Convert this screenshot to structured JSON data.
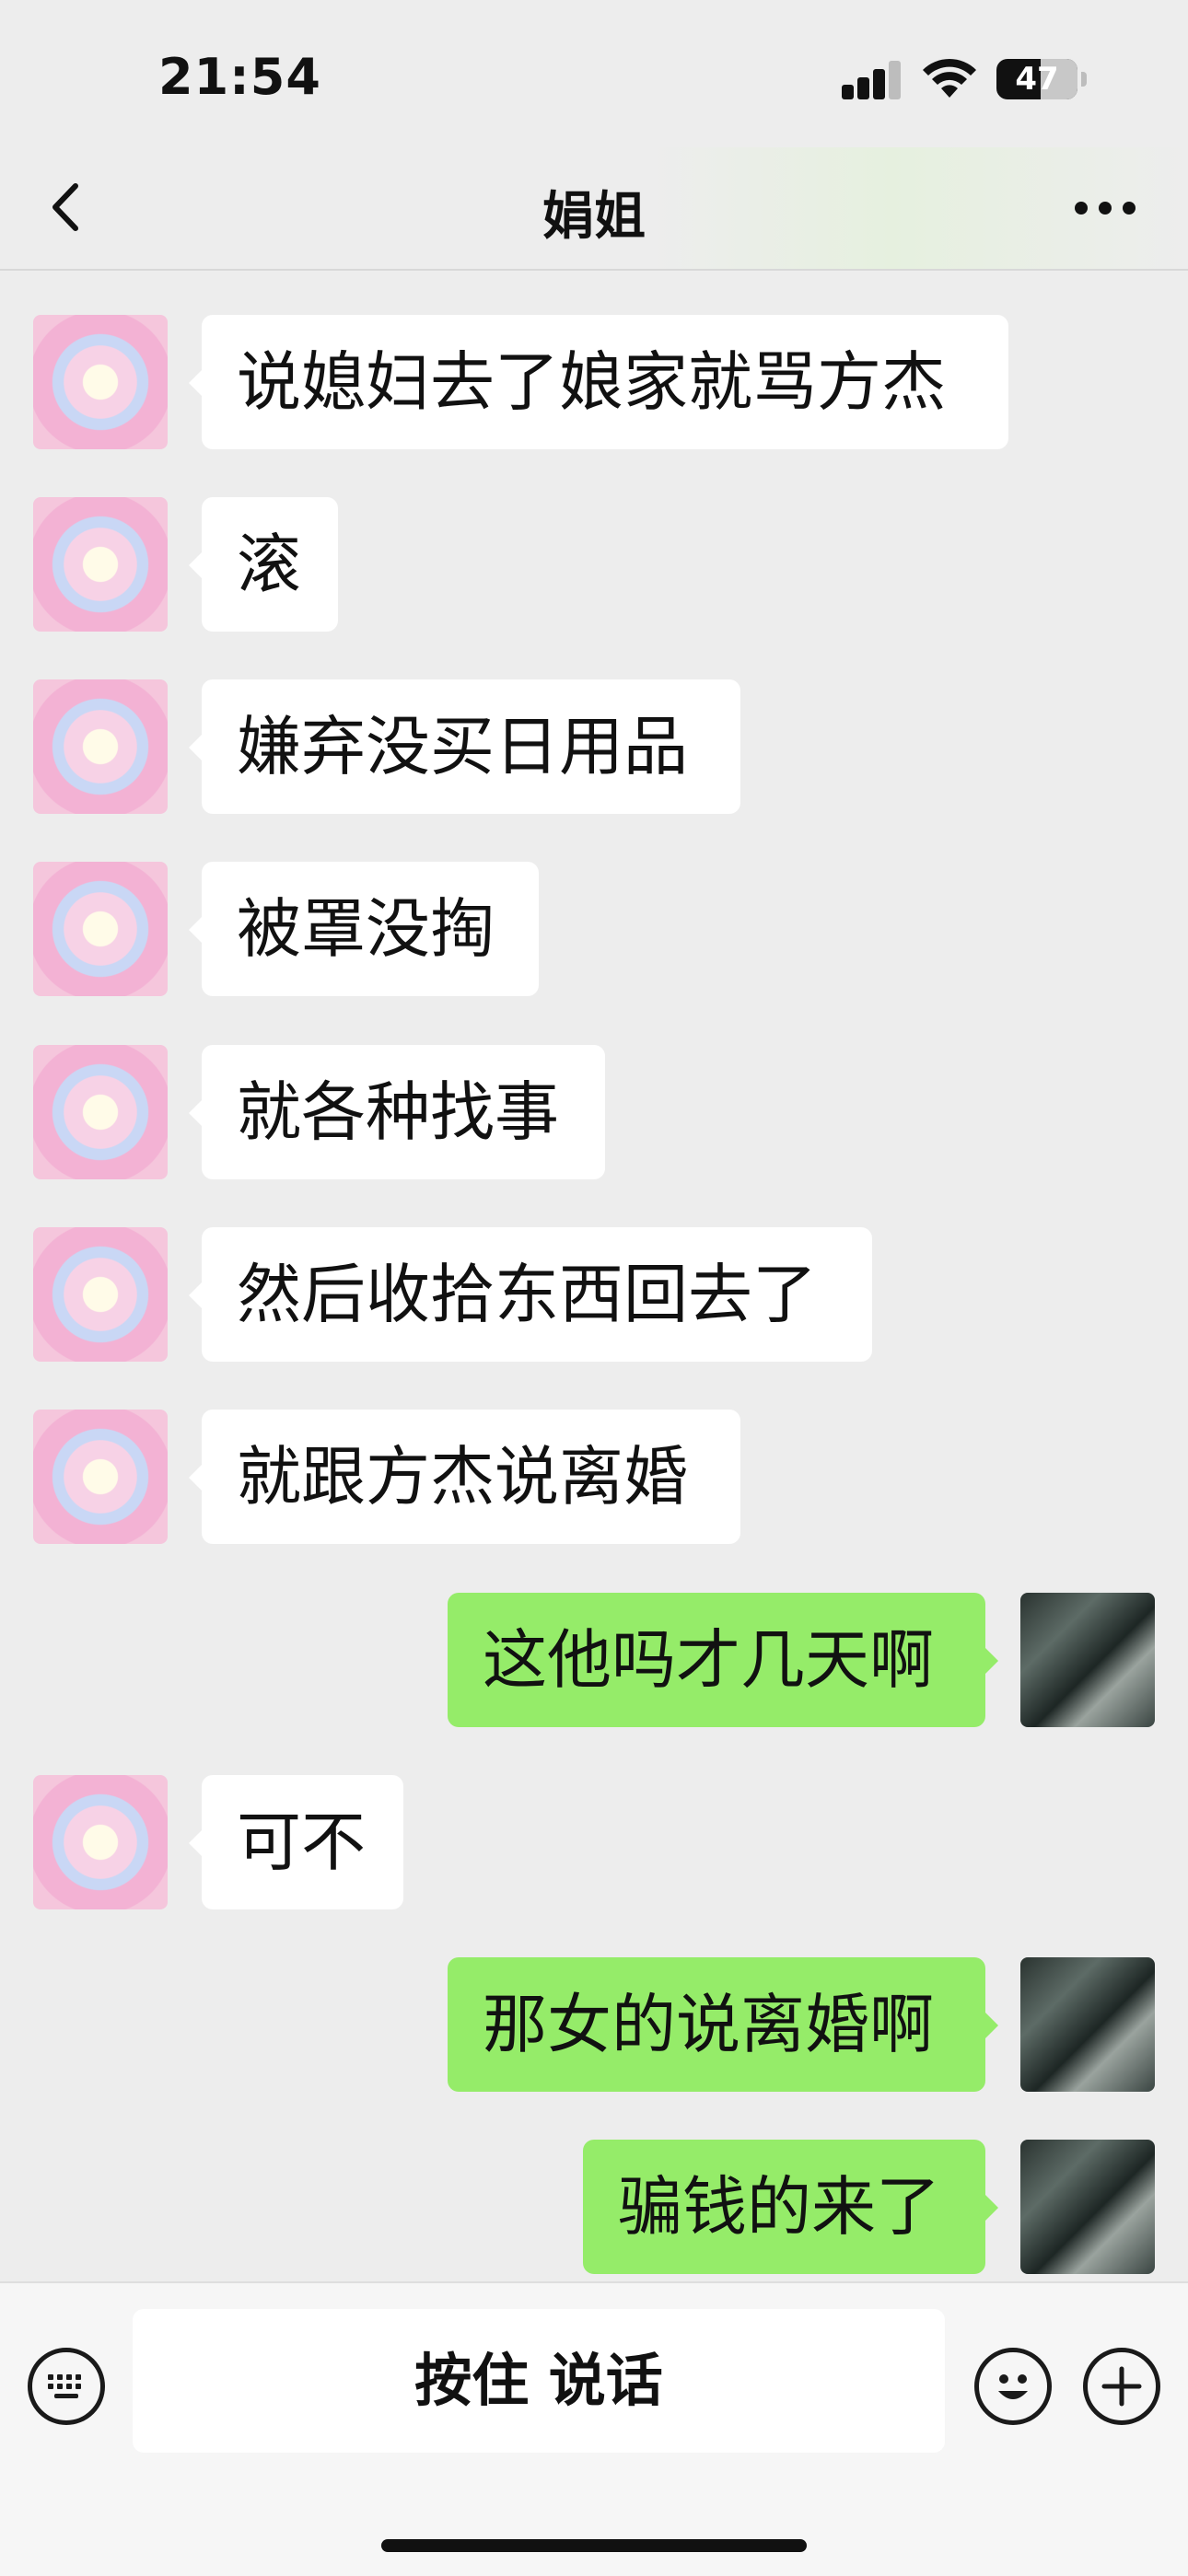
{
  "status_bar": {
    "time": "21:54",
    "battery": "47"
  },
  "nav": {
    "title": "娟姐",
    "back_icon": "chevron-left-icon",
    "more_icon": "more-dots-icon"
  },
  "messages": [
    {
      "side": "in",
      "text": "说媳妇去了娘家就骂方杰"
    },
    {
      "side": "in",
      "text": "滚"
    },
    {
      "side": "in",
      "text": "嫌弃没买日用品"
    },
    {
      "side": "in",
      "text": "被罩没掏"
    },
    {
      "side": "in",
      "text": "就各种找事"
    },
    {
      "side": "in",
      "text": "然后收拾东西回去了"
    },
    {
      "side": "in",
      "text": "就跟方杰说离婚"
    },
    {
      "side": "out",
      "text": "这他吗才几天啊"
    },
    {
      "side": "in",
      "text": "可不"
    },
    {
      "side": "out",
      "text": "那女的说离婚啊"
    },
    {
      "side": "out",
      "text": "骗钱的来了"
    }
  ],
  "input_bar": {
    "hold_to_talk": "按住 说话"
  }
}
